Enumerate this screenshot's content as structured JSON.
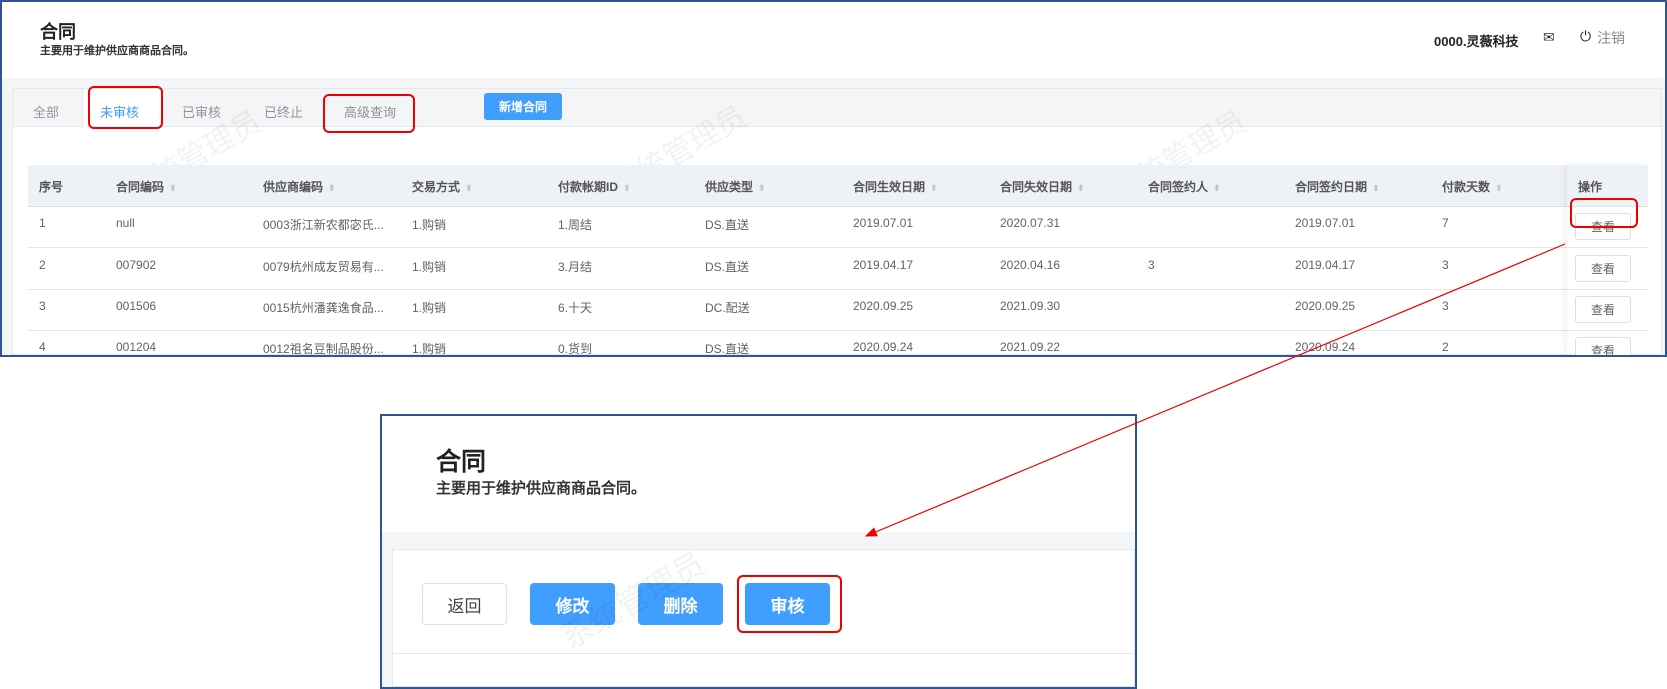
{
  "header": {
    "title": "合同",
    "subtitle": "主要用于维护供应商商品合同。",
    "company": "0000.灵薇科技",
    "logout": "注销",
    "mail_icon": "mail-icon",
    "power_icon": "power-icon"
  },
  "tabs": [
    {
      "label": "全部"
    },
    {
      "label": "未审核"
    },
    {
      "label": "已审核"
    },
    {
      "label": "已终止"
    },
    {
      "label": "高级查询"
    }
  ],
  "add_button": "新增合同",
  "watermark": "系统管理员",
  "table": {
    "columns": [
      "序号",
      "合同编码",
      "供应商编码",
      "交易方式",
      "付款帐期ID",
      "供应类型",
      "合同生效日期",
      "合同失效日期",
      "合同签约人",
      "合同签约日期",
      "付款天数",
      "操作"
    ],
    "rows": [
      [
        "1",
        "null",
        "0003浙江新农都宓氏...",
        "1.购销",
        "1.周结",
        "DS.直送",
        "2019.07.01",
        "2020.07.31",
        "",
        "2019.07.01",
        "7"
      ],
      [
        "2",
        "007902",
        "0079杭州成友贸易有...",
        "1.购销",
        "3.月结",
        "DS.直送",
        "2019.04.17",
        "2020.04.16",
        "3",
        "2019.04.17",
        "3"
      ],
      [
        "3",
        "001506",
        "0015杭州潘龚逸食品...",
        "1.购销",
        "6.十天",
        "DC.配送",
        "2020.09.25",
        "2021.09.30",
        "",
        "2020.09.25",
        "3"
      ],
      [
        "4",
        "001204",
        "0012祖名豆制品股份...",
        "1.购销",
        "0.货到",
        "DS.直送",
        "2020.09.24",
        "2021.09.22",
        "",
        "2020.09.24",
        "2"
      ]
    ],
    "view_label": "查看"
  },
  "detail": {
    "title": "合同",
    "subtitle": "主要用于维护供应商商品合同。",
    "buttons": {
      "back": "返回",
      "edit": "修改",
      "delete": "删除",
      "audit": "审核"
    }
  }
}
